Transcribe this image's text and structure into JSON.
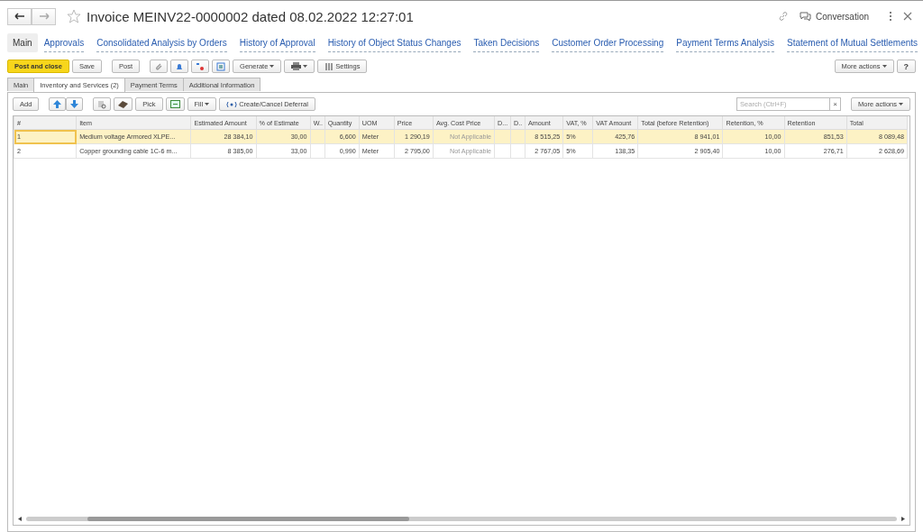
{
  "window": {
    "title": "Invoice MEINV22-0000002 dated 08.02.2022 12:27:01",
    "favorite": false,
    "conversation": "Conversation"
  },
  "nav": [
    {
      "label": "Main",
      "selected": true
    },
    {
      "label": "Approvals",
      "selected": false
    },
    {
      "label": "Consolidated Analysis by Orders",
      "selected": false
    },
    {
      "label": "History of Approval",
      "selected": false
    },
    {
      "label": "History of Object Status Changes",
      "selected": false
    },
    {
      "label": "Taken Decisions",
      "selected": false
    },
    {
      "label": "Customer Order Processing",
      "selected": false
    },
    {
      "label": "Payment Terms Analysis",
      "selected": false
    },
    {
      "label": "Statement of Mutual Settlements",
      "selected": false
    }
  ],
  "toolbar": {
    "post_and_close": "Post and close",
    "save": "Save",
    "post": "Post",
    "generate": "Generate",
    "settings": "Settings",
    "more_actions": "More actions",
    "help": "?"
  },
  "tabs": [
    {
      "label": "Main",
      "selected": false
    },
    {
      "label": "Inventory and Services (2)",
      "selected": true
    },
    {
      "label": "Payment Terms",
      "selected": false
    },
    {
      "label": "Additional Information",
      "selected": false
    }
  ],
  "table_toolbar": {
    "add": "Add",
    "pick": "Pick",
    "fill": "Fill",
    "deferral": "Create/Cancel Deferral",
    "search_placeholder": "Search (Ctrl+F)",
    "clear": "×",
    "more_actions": "More actions"
  },
  "table": {
    "columns": [
      {
        "label": "#",
        "kind": "text"
      },
      {
        "label": "Item",
        "kind": "text"
      },
      {
        "label": "Estimated Amount",
        "kind": "number"
      },
      {
        "label": "% of Estimate",
        "kind": "number"
      },
      {
        "label": "W..",
        "kind": "text"
      },
      {
        "label": "Quantity",
        "kind": "number"
      },
      {
        "label": "UOM",
        "kind": "text"
      },
      {
        "label": "Price",
        "kind": "number"
      },
      {
        "label": "Avg. Cost Price",
        "kind": "muted"
      },
      {
        "label": "D...",
        "kind": "text"
      },
      {
        "label": "D..",
        "kind": "text"
      },
      {
        "label": "Amount",
        "kind": "number"
      },
      {
        "label": "VAT, %",
        "kind": "text"
      },
      {
        "label": "VAT Amount",
        "kind": "number"
      },
      {
        "label": "Total (before Retention)",
        "kind": "number"
      },
      {
        "label": "Retention, %",
        "kind": "number"
      },
      {
        "label": "Retention",
        "kind": "number"
      },
      {
        "label": "Total",
        "kind": "number"
      }
    ],
    "rows": [
      {
        "selected": true,
        "cells": [
          "1",
          "Medium voltage Armored XLPE...",
          "28 384,10",
          "30,00",
          "",
          "6,600",
          "Meter",
          "1 290,19",
          "Not Applicable",
          "",
          "",
          "8 515,25",
          "5%",
          "425,76",
          "8 941,01",
          "10,00",
          "851,53",
          "8 089,48"
        ]
      },
      {
        "selected": false,
        "cells": [
          "2",
          "Copper grounding cable 1C-6 m...",
          "8 385,00",
          "33,00",
          "",
          "0,990",
          "Meter",
          "2 795,00",
          "Not Applicable",
          "",
          "",
          "2 767,05",
          "5%",
          "138,35",
          "2 905,40",
          "10,00",
          "276,71",
          "2 628,69"
        ]
      }
    ]
  }
}
